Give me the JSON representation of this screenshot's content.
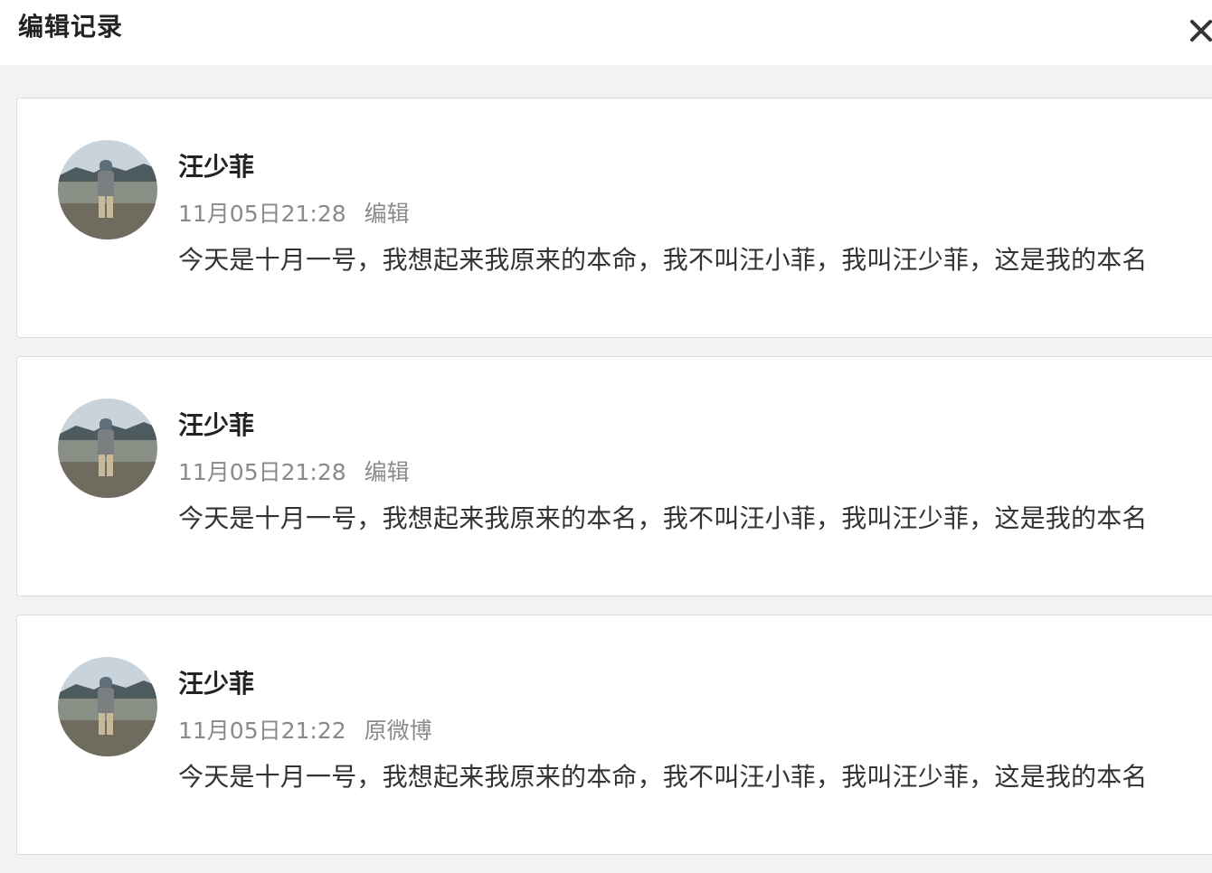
{
  "header": {
    "title": "编辑记录"
  },
  "close_icon": "close-icon",
  "records": [
    {
      "author": "汪少菲",
      "time": "11月05日21:28",
      "action": "编辑",
      "content": "今天是十月一号，我想起来我原来的本命，我不叫汪小菲，我叫汪少菲，这是我的本名"
    },
    {
      "author": "汪少菲",
      "time": "11月05日21:28",
      "action": "编辑",
      "content": "今天是十月一号，我想起来我原来的本名，我不叫汪小菲，我叫汪少菲，这是我的本名"
    },
    {
      "author": "汪少菲",
      "time": "11月05日21:22",
      "action": "原微博",
      "content": "今天是十月一号，我想起来我原来的本命，我不叫汪小菲，我叫汪少菲，这是我的本名"
    }
  ],
  "colors": {
    "page_bg": "#f2f2f5",
    "card_bg": "#ffffff",
    "meta_text": "#8a8a8a",
    "body_text": "#333333"
  }
}
